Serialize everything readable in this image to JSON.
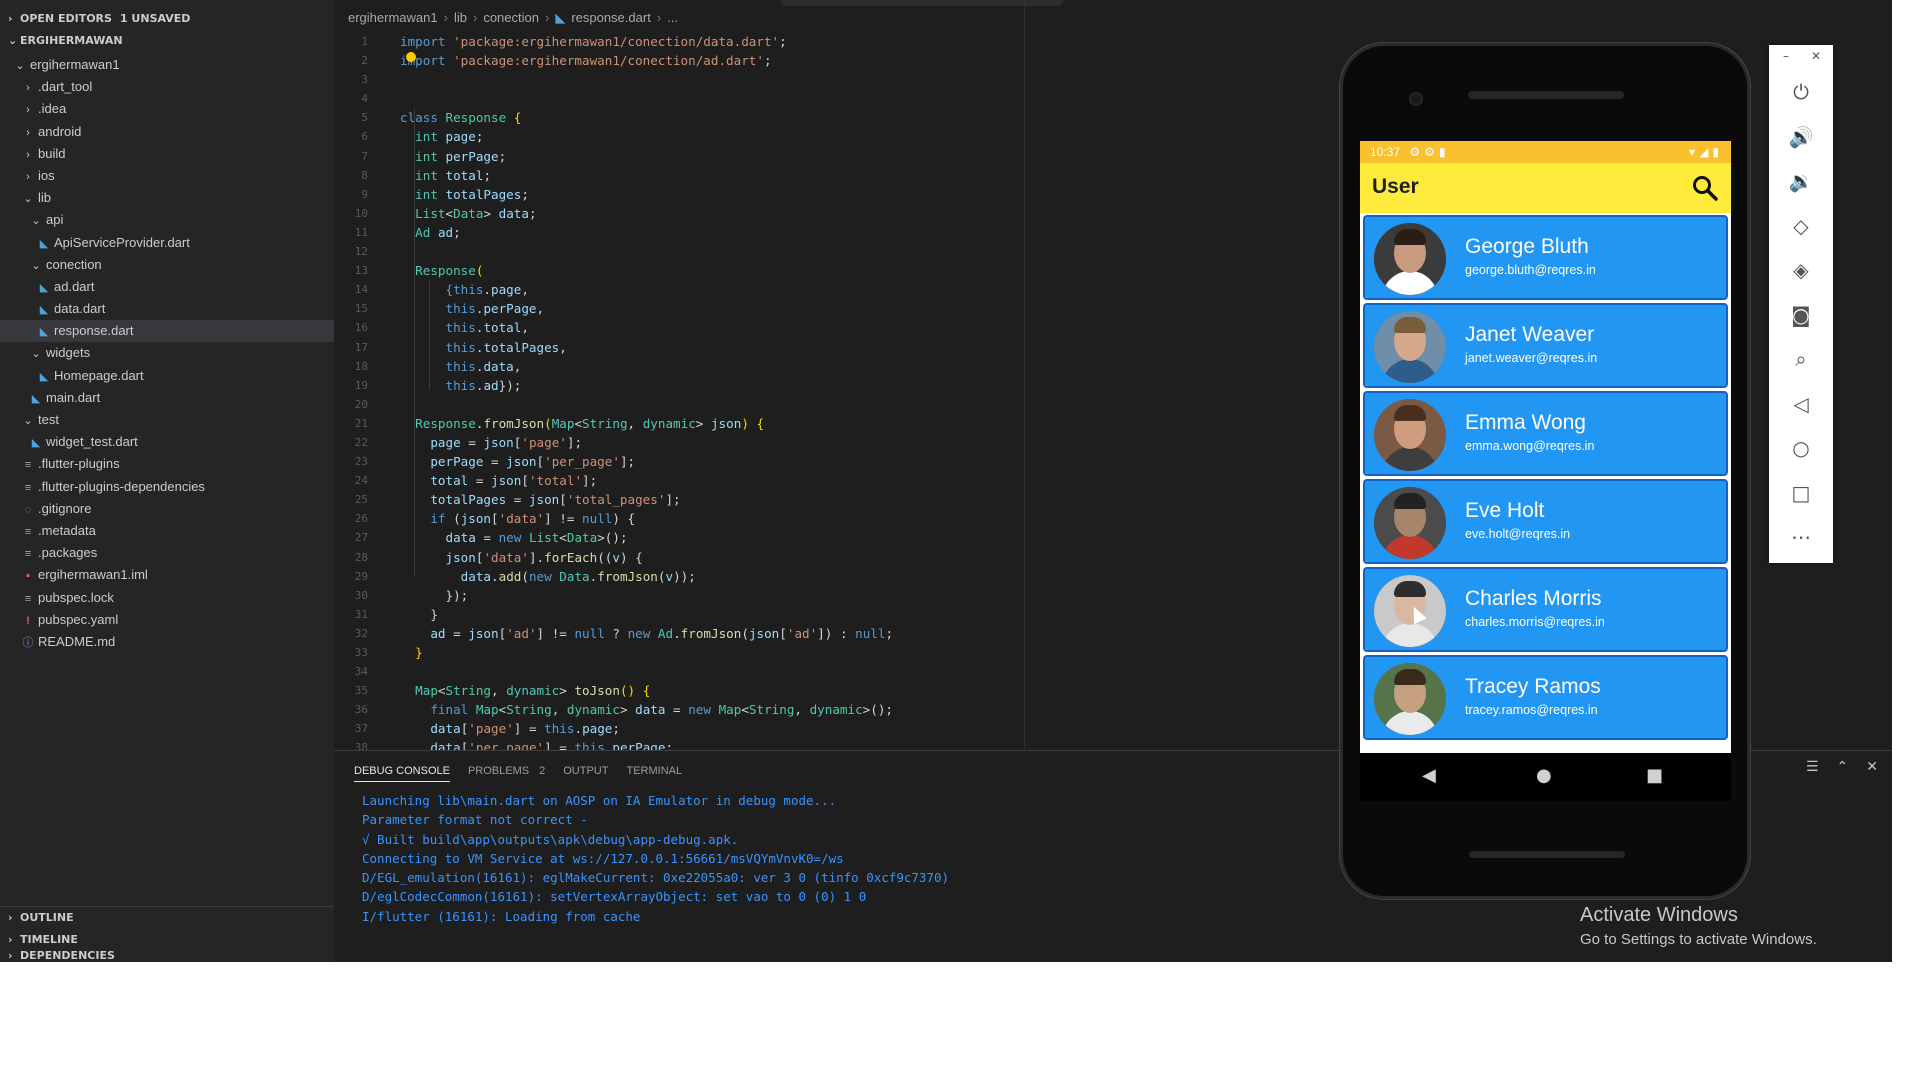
{
  "sidebar": {
    "open_editors_label": "OPEN EDITORS",
    "open_editors_badge": "1 UNSAVED",
    "project_label": "ERGIHERMAWAN",
    "tree": [
      {
        "label": "ergihermawan1",
        "indent": 1,
        "icon": "chevron-down",
        "selected": false
      },
      {
        "label": ".dart_tool",
        "indent": 2,
        "icon": "chevron-right",
        "selected": false
      },
      {
        "label": ".idea",
        "indent": 2,
        "icon": "chevron-right",
        "selected": false
      },
      {
        "label": "android",
        "indent": 2,
        "icon": "chevron-right",
        "selected": false
      },
      {
        "label": "build",
        "indent": 2,
        "icon": "chevron-right",
        "selected": false
      },
      {
        "label": "ios",
        "indent": 2,
        "icon": "chevron-right",
        "selected": false
      },
      {
        "label": "lib",
        "indent": 2,
        "icon": "chevron-down",
        "selected": false
      },
      {
        "label": "api",
        "indent": 3,
        "icon": "chevron-down",
        "selected": false
      },
      {
        "label": "ApiServiceProvider.dart",
        "indent": 4,
        "icon": "dart",
        "selected": false
      },
      {
        "label": "conection",
        "indent": 3,
        "icon": "chevron-down",
        "selected": false
      },
      {
        "label": "ad.dart",
        "indent": 4,
        "icon": "dart",
        "selected": false
      },
      {
        "label": "data.dart",
        "indent": 4,
        "icon": "dart",
        "selected": false
      },
      {
        "label": "response.dart",
        "indent": 4,
        "icon": "dart",
        "selected": true
      },
      {
        "label": "widgets",
        "indent": 3,
        "icon": "chevron-down",
        "selected": false
      },
      {
        "label": "Homepage.dart",
        "indent": 4,
        "icon": "dart",
        "selected": false
      },
      {
        "label": "main.dart",
        "indent": 3,
        "icon": "dart",
        "selected": false
      },
      {
        "label": "test",
        "indent": 2,
        "icon": "chevron-down",
        "selected": false
      },
      {
        "label": "widget_test.dart",
        "indent": 3,
        "icon": "dart",
        "selected": false
      },
      {
        "label": ".flutter-plugins",
        "indent": 2,
        "icon": "lines",
        "selected": false
      },
      {
        "label": ".flutter-plugins-dependencies",
        "indent": 2,
        "icon": "lines",
        "selected": false
      },
      {
        "label": ".gitignore",
        "indent": 2,
        "icon": "circle",
        "selected": false
      },
      {
        "label": ".metadata",
        "indent": 2,
        "icon": "lines",
        "selected": false
      },
      {
        "label": ".packages",
        "indent": 2,
        "icon": "lines",
        "selected": false
      },
      {
        "label": "ergihermawan1.iml",
        "indent": 2,
        "icon": "red",
        "selected": false
      },
      {
        "label": "pubspec.lock",
        "indent": 2,
        "icon": "lines",
        "selected": false
      },
      {
        "label": "pubspec.yaml",
        "indent": 2,
        "icon": "bang",
        "selected": false
      },
      {
        "label": "README.md",
        "indent": 2,
        "icon": "info",
        "selected": false
      }
    ],
    "outline_label": "OUTLINE",
    "timeline_label": "TIMELINE",
    "dependencies_label": "DEPENDENCIES"
  },
  "editor": {
    "breadcrumb": [
      "ergihermawan1",
      "lib",
      "conection",
      "response.dart",
      "..."
    ],
    "lines": [
      [
        [
          "k",
          "import"
        ],
        [
          "p",
          " "
        ],
        [
          "s",
          "'package:ergihermawan1/conection/data.dart'"
        ],
        [
          "p",
          ";"
        ]
      ],
      [
        [
          "k",
          "import"
        ],
        [
          "p",
          " "
        ],
        [
          "s",
          "'package:ergihermawan1/conection/ad.dart'"
        ],
        [
          "p",
          ";"
        ]
      ],
      [],
      [],
      [
        [
          "k",
          "class"
        ],
        [
          "p",
          " "
        ],
        [
          "t",
          "Response"
        ],
        [
          "p",
          " "
        ],
        [
          "y",
          "{"
        ]
      ],
      [
        [
          "p",
          "  "
        ],
        [
          "t",
          "int"
        ],
        [
          "p",
          " "
        ],
        [
          "v",
          "page"
        ],
        [
          "p",
          ";"
        ]
      ],
      [
        [
          "p",
          "  "
        ],
        [
          "t",
          "int"
        ],
        [
          "p",
          " "
        ],
        [
          "v",
          "perPage"
        ],
        [
          "p",
          ";"
        ]
      ],
      [
        [
          "p",
          "  "
        ],
        [
          "t",
          "int"
        ],
        [
          "p",
          " "
        ],
        [
          "v",
          "total"
        ],
        [
          "p",
          ";"
        ]
      ],
      [
        [
          "p",
          "  "
        ],
        [
          "t",
          "int"
        ],
        [
          "p",
          " "
        ],
        [
          "v",
          "totalPages"
        ],
        [
          "p",
          ";"
        ]
      ],
      [
        [
          "p",
          "  "
        ],
        [
          "t",
          "List"
        ],
        [
          "p",
          "<"
        ],
        [
          "t",
          "Data"
        ],
        [
          "p",
          "> "
        ],
        [
          "v",
          "data"
        ],
        [
          "p",
          ";"
        ]
      ],
      [
        [
          "p",
          "  "
        ],
        [
          "t",
          "Ad"
        ],
        [
          "p",
          " "
        ],
        [
          "v",
          "ad"
        ],
        [
          "p",
          ";"
        ]
      ],
      [],
      [
        [
          "p",
          "  "
        ],
        [
          "t",
          "Response"
        ],
        [
          "y",
          "("
        ]
      ],
      [
        [
          "p",
          "      "
        ],
        [
          "k",
          "{this"
        ],
        [
          "p",
          "."
        ],
        [
          "v",
          "page"
        ],
        [
          "p",
          ","
        ]
      ],
      [
        [
          "p",
          "      "
        ],
        [
          "k",
          "this"
        ],
        [
          "p",
          "."
        ],
        [
          "v",
          "perPage"
        ],
        [
          "p",
          ","
        ]
      ],
      [
        [
          "p",
          "      "
        ],
        [
          "k",
          "this"
        ],
        [
          "p",
          "."
        ],
        [
          "v",
          "total"
        ],
        [
          "p",
          ","
        ]
      ],
      [
        [
          "p",
          "      "
        ],
        [
          "k",
          "this"
        ],
        [
          "p",
          "."
        ],
        [
          "v",
          "totalPages"
        ],
        [
          "p",
          ","
        ]
      ],
      [
        [
          "p",
          "      "
        ],
        [
          "k",
          "this"
        ],
        [
          "p",
          "."
        ],
        [
          "v",
          "data"
        ],
        [
          "p",
          ","
        ]
      ],
      [
        [
          "p",
          "      "
        ],
        [
          "k",
          "this"
        ],
        [
          "p",
          "."
        ],
        [
          "v",
          "ad"
        ],
        [
          "p",
          "});"
        ]
      ],
      [],
      [
        [
          "p",
          "  "
        ],
        [
          "t",
          "Response"
        ],
        [
          "p",
          "."
        ],
        [
          "f",
          "fromJson"
        ],
        [
          "y",
          "("
        ],
        [
          "t",
          "Map"
        ],
        [
          "p",
          "<"
        ],
        [
          "t",
          "String"
        ],
        [
          "p",
          ", "
        ],
        [
          "t",
          "dynamic"
        ],
        [
          "p",
          "> "
        ],
        [
          "v",
          "json"
        ],
        [
          "y",
          ")"
        ],
        [
          "p",
          " "
        ],
        [
          "y",
          "{"
        ]
      ],
      [
        [
          "p",
          "    "
        ],
        [
          "v",
          "page"
        ],
        [
          "p",
          " = "
        ],
        [
          "v",
          "json"
        ],
        [
          "p",
          "["
        ],
        [
          "s",
          "'page'"
        ],
        [
          "p",
          "];"
        ]
      ],
      [
        [
          "p",
          "    "
        ],
        [
          "v",
          "perPage"
        ],
        [
          "p",
          " = "
        ],
        [
          "v",
          "json"
        ],
        [
          "p",
          "["
        ],
        [
          "s",
          "'per_page'"
        ],
        [
          "p",
          "];"
        ]
      ],
      [
        [
          "p",
          "    "
        ],
        [
          "v",
          "total"
        ],
        [
          "p",
          " = "
        ],
        [
          "v",
          "json"
        ],
        [
          "p",
          "["
        ],
        [
          "s",
          "'total'"
        ],
        [
          "p",
          "];"
        ]
      ],
      [
        [
          "p",
          "    "
        ],
        [
          "v",
          "totalPages"
        ],
        [
          "p",
          " = "
        ],
        [
          "v",
          "json"
        ],
        [
          "p",
          "["
        ],
        [
          "s",
          "'total_pages'"
        ],
        [
          "p",
          "];"
        ]
      ],
      [
        [
          "p",
          "    "
        ],
        [
          "k",
          "if"
        ],
        [
          "p",
          " ("
        ],
        [
          "v",
          "json"
        ],
        [
          "p",
          "["
        ],
        [
          "s",
          "'data'"
        ],
        [
          "p",
          "] != "
        ],
        [
          "k",
          "null"
        ],
        [
          "p",
          ") {"
        ]
      ],
      [
        [
          "p",
          "      "
        ],
        [
          "v",
          "data"
        ],
        [
          "p",
          " = "
        ],
        [
          "k",
          "new"
        ],
        [
          "p",
          " "
        ],
        [
          "t",
          "List"
        ],
        [
          "p",
          "<"
        ],
        [
          "t",
          "Data"
        ],
        [
          "p",
          ">();"
        ]
      ],
      [
        [
          "p",
          "      "
        ],
        [
          "v",
          "json"
        ],
        [
          "p",
          "["
        ],
        [
          "s",
          "'data'"
        ],
        [
          "p",
          "]."
        ],
        [
          "f",
          "forEach"
        ],
        [
          "p",
          "(("
        ],
        [
          "v",
          "v"
        ],
        [
          "p",
          ") {"
        ]
      ],
      [
        [
          "p",
          "        "
        ],
        [
          "v",
          "data"
        ],
        [
          "p",
          "."
        ],
        [
          "f",
          "add"
        ],
        [
          "p",
          "("
        ],
        [
          "k",
          "new"
        ],
        [
          "p",
          " "
        ],
        [
          "t",
          "Data"
        ],
        [
          "p",
          "."
        ],
        [
          "f",
          "fromJson"
        ],
        [
          "p",
          "("
        ],
        [
          "v",
          "v"
        ],
        [
          "p",
          "));"
        ]
      ],
      [
        [
          "p",
          "      });"
        ]
      ],
      [
        [
          "p",
          "    }"
        ]
      ],
      [
        [
          "p",
          "    "
        ],
        [
          "v",
          "ad"
        ],
        [
          "p",
          " = "
        ],
        [
          "v",
          "json"
        ],
        [
          "p",
          "["
        ],
        [
          "s",
          "'ad'"
        ],
        [
          "p",
          "] != "
        ],
        [
          "k",
          "null"
        ],
        [
          "p",
          " ? "
        ],
        [
          "k",
          "new"
        ],
        [
          "p",
          " "
        ],
        [
          "t",
          "Ad"
        ],
        [
          "p",
          "."
        ],
        [
          "f",
          "fromJson"
        ],
        [
          "p",
          "("
        ],
        [
          "v",
          "json"
        ],
        [
          "p",
          "["
        ],
        [
          "s",
          "'ad'"
        ],
        [
          "p",
          "]) : "
        ],
        [
          "k",
          "null"
        ],
        [
          "p",
          ";"
        ]
      ],
      [
        [
          "p",
          "  "
        ],
        [
          "y",
          "}"
        ]
      ],
      [],
      [
        [
          "p",
          "  "
        ],
        [
          "t",
          "Map"
        ],
        [
          "p",
          "<"
        ],
        [
          "t",
          "String"
        ],
        [
          "p",
          ", "
        ],
        [
          "t",
          "dynamic"
        ],
        [
          "p",
          "> "
        ],
        [
          "f",
          "toJson"
        ],
        [
          "y",
          "()"
        ],
        [
          "p",
          " "
        ],
        [
          "y",
          "{"
        ]
      ],
      [
        [
          "p",
          "    "
        ],
        [
          "k",
          "final"
        ],
        [
          "p",
          " "
        ],
        [
          "t",
          "Map"
        ],
        [
          "p",
          "<"
        ],
        [
          "t",
          "String"
        ],
        [
          "p",
          ", "
        ],
        [
          "t",
          "dynamic"
        ],
        [
          "p",
          "> "
        ],
        [
          "v",
          "data"
        ],
        [
          "p",
          " = "
        ],
        [
          "k",
          "new"
        ],
        [
          "p",
          " "
        ],
        [
          "t",
          "Map"
        ],
        [
          "p",
          "<"
        ],
        [
          "t",
          "String"
        ],
        [
          "p",
          ", "
        ],
        [
          "t",
          "dynamic"
        ],
        [
          "p",
          ">();"
        ]
      ],
      [
        [
          "p",
          "    "
        ],
        [
          "v",
          "data"
        ],
        [
          "p",
          "["
        ],
        [
          "s",
          "'page'"
        ],
        [
          "p",
          "] = "
        ],
        [
          "k",
          "this"
        ],
        [
          "p",
          "."
        ],
        [
          "v",
          "page"
        ],
        [
          "p",
          ";"
        ]
      ],
      [
        [
          "p",
          "    "
        ],
        [
          "v",
          "data"
        ],
        [
          "p",
          "["
        ],
        [
          "s",
          "'per_page'"
        ],
        [
          "p",
          "] = "
        ],
        [
          "k",
          "this"
        ],
        [
          "p",
          "."
        ],
        [
          "v",
          "perPage"
        ],
        [
          "p",
          ";"
        ]
      ]
    ]
  },
  "panel": {
    "tabs": [
      {
        "label": "DEBUG CONSOLE",
        "active": true,
        "count": ""
      },
      {
        "label": "PROBLEMS",
        "active": false,
        "count": "2"
      },
      {
        "label": "OUTPUT",
        "active": false,
        "count": ""
      },
      {
        "label": "TERMINAL",
        "active": false,
        "count": ""
      }
    ],
    "console": [
      "Launching lib\\main.dart on AOSP on IA Emulator in debug mode...",
      "Parameter format not correct -",
      "√ Built build\\app\\outputs\\apk\\debug\\app-debug.apk.",
      "Connecting to VM Service at ws://127.0.0.1:56661/msVQYmVnvK0=/ws",
      "D/EGL_emulation(16161): eglMakeCurrent: 0xe22055a0: ver 3 0 (tinfo 0xcf9c7370)",
      "D/eglCodecCommon(16161): setVertexArrayObject: set vao to 0 (0) 1 0",
      "I/flutter (16161): Loading from cache"
    ]
  },
  "phone": {
    "time": "10:37",
    "app_title": "User",
    "colors": {
      "status": "#fbc02d",
      "appbar": "#ffeb3b",
      "card": "#2196f3",
      "card_border": "#1565c0"
    },
    "users": [
      {
        "name": "George Bluth",
        "email": "george.bluth@reqres.in",
        "avatar": {
          "bg": "#3b3b3b",
          "skin": "#c99a7d",
          "hair": "#2a1d15",
          "shirt": "#ffffff"
        }
      },
      {
        "name": "Janet Weaver",
        "email": "janet.weaver@reqres.in",
        "avatar": {
          "bg": "#6f8fa8",
          "skin": "#d6a78a",
          "hair": "#7a5b3a",
          "shirt": "#2f5d8a"
        }
      },
      {
        "name": "Emma Wong",
        "email": "emma.wong@reqres.in",
        "avatar": {
          "bg": "#7a5a44",
          "skin": "#cf9d7e",
          "hair": "#4a2f1f",
          "shirt": "#3e3e3e"
        }
      },
      {
        "name": "Eve Holt",
        "email": "eve.holt@reqres.in",
        "avatar": {
          "bg": "#4b4b4b",
          "skin": "#a6856a",
          "hair": "#222222",
          "shirt": "#c0392b"
        }
      },
      {
        "name": "Charles Morris",
        "email": "charles.morris@reqres.in",
        "avatar": {
          "bg": "#c9c9c9",
          "skin": "#d8b8a0",
          "hair": "#2d2d2d",
          "shirt": "#e8e8e8"
        }
      },
      {
        "name": "Tracey Ramos",
        "email": "tracey.ramos@reqres.in",
        "avatar": {
          "bg": "#55744a",
          "skin": "#c7a082",
          "hair": "#3a2a1c",
          "shirt": "#eaeaea"
        }
      }
    ]
  },
  "emulator_toolbar": [
    "power-icon",
    "volume-up-icon",
    "volume-down-icon",
    "rotate-left-icon",
    "rotate-right-icon",
    "camera-icon",
    "zoom-icon",
    "back-icon",
    "home-icon",
    "overview-icon",
    "more-icon"
  ],
  "watermark": {
    "line1": "Activate Windows",
    "line2": "Go to Settings to activate Windows."
  }
}
